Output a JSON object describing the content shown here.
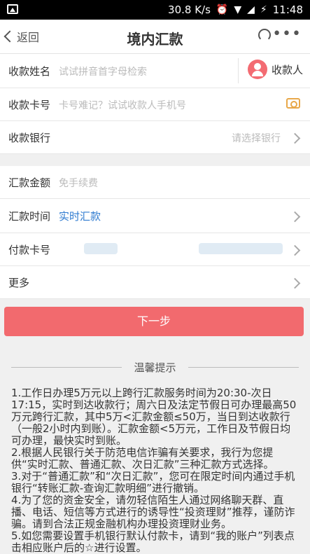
{
  "status_bar": {
    "speed": "30.8 K/s",
    "time": "11:48"
  },
  "nav": {
    "back_label": "返回",
    "title": "境内汇款"
  },
  "form": {
    "name": {
      "label": "收款姓名",
      "placeholder": "试试拼音首字母检索",
      "payee_button": "收款人"
    },
    "card": {
      "label": "收款卡号",
      "placeholder": "卡号难记？试试收款人手机号"
    },
    "bank": {
      "label": "收款银行",
      "placeholder": "请选择银行"
    },
    "amount": {
      "label": "汇款金额",
      "placeholder": "免手续费"
    },
    "time": {
      "label": "汇款时间",
      "value": "实时汇款"
    },
    "pay_card": {
      "label": "付款卡号"
    },
    "more": {
      "label": "更多"
    }
  },
  "actions": {
    "next_label": "下一步"
  },
  "tips": {
    "title": "温馨提示",
    "items": [
      "1.工作日办理5万元以上跨行汇款服务时间为20:30-次日17:15，实时到达收款行；周六日及法定节假日可办理最高50万元跨行汇款，其中5万<汇款金额≤50万，当日到达收款行（一般2小时内到账）。汇款金额<5万元，工作日及节假日均可办理，最快实时到账。",
      "2.根据人民银行关于防范电信诈骗有关要求，我行为您提供“实时汇款、普通汇款、次日汇款”三种汇款方式选择。",
      "3.对于“普通汇款”和“次日汇款”，您可在限定时间内通过手机银行“转账汇款-查询汇款明细”进行撤销。",
      "4.为了您的资金安全，请勿轻信陌生人通过网络聊天群、直播、电话、短信等方式进行的诱导性“投资理财”推荐，谨防诈骗。请到合法正规金融机构办理投资理财业务。",
      "5.如您需要设置手机银行默认付款卡，请到“我的账户”列表点击相应账户后的☆进行设置。"
    ]
  }
}
